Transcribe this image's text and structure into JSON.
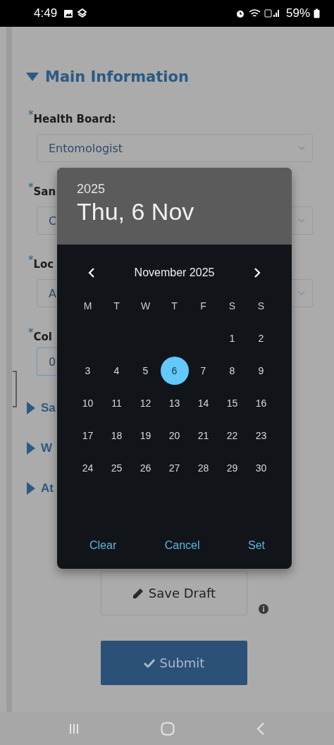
{
  "status_bar": {
    "time": "4:49",
    "battery": "59%"
  },
  "form": {
    "section": {
      "title": "Main Information",
      "expanded": true
    },
    "fields": [
      {
        "kind": "select",
        "required_mark": "*",
        "label": "Health Board:",
        "value": "Entomologist"
      },
      {
        "kind": "select",
        "required_mark": "*",
        "label": "San",
        "value": "C"
      },
      {
        "kind": "select",
        "required_mark": "*",
        "label": "Loc",
        "value": "A"
      },
      {
        "kind": "input",
        "required_mark": "*",
        "label": "Col",
        "value": "0"
      }
    ],
    "sections": [
      {
        "title": "Sa",
        "expanded": false
      },
      {
        "title": "W",
        "expanded": false
      },
      {
        "title": "At",
        "expanded": false
      }
    ]
  },
  "buttons": [
    {
      "kind": "secondary",
      "label": "Save Draft"
    },
    {
      "kind": "primary",
      "label": "Submit"
    }
  ],
  "date_picker": {
    "year": "2025",
    "date": "Thu, 6 Nov",
    "month": "November 2025",
    "weekdays": [
      "M",
      "T",
      "W",
      "T",
      "F",
      "S",
      "S"
    ],
    "weeks": [
      [
        {
          "kind": "empty"
        },
        {
          "kind": "empty"
        },
        {
          "kind": "empty"
        },
        {
          "kind": "empty"
        },
        {
          "kind": "empty"
        },
        {
          "day": "1",
          "selected": false
        },
        {
          "day": "2",
          "selected": false
        }
      ],
      [
        {
          "day": "3",
          "selected": false
        },
        {
          "day": "4",
          "selected": false
        },
        {
          "day": "5",
          "selected": false
        },
        {
          "day": "6",
          "selected": true
        },
        {
          "day": "7",
          "selected": false
        },
        {
          "day": "8",
          "selected": false
        },
        {
          "day": "9",
          "selected": false
        }
      ],
      [
        {
          "day": "10",
          "selected": false
        },
        {
          "day": "11",
          "selected": false
        },
        {
          "day": "12",
          "selected": false
        },
        {
          "day": "13",
          "selected": false
        },
        {
          "day": "14",
          "selected": false
        },
        {
          "day": "15",
          "selected": false
        },
        {
          "day": "16",
          "selected": false
        }
      ],
      [
        {
          "day": "17",
          "selected": false
        },
        {
          "day": "18",
          "selected": false
        },
        {
          "day": "19",
          "selected": false
        },
        {
          "day": "20",
          "selected": false
        },
        {
          "day": "21",
          "selected": false
        },
        {
          "day": "22",
          "selected": false
        },
        {
          "day": "23",
          "selected": false
        }
      ],
      [
        {
          "day": "24",
          "selected": false
        },
        {
          "day": "25",
          "selected": false
        },
        {
          "day": "26",
          "selected": false
        },
        {
          "day": "27",
          "selected": false
        },
        {
          "day": "28",
          "selected": false
        },
        {
          "day": "29",
          "selected": false
        },
        {
          "day": "30",
          "selected": false
        }
      ]
    ],
    "actions": [
      "Clear",
      "Cancel",
      "Set"
    ]
  }
}
